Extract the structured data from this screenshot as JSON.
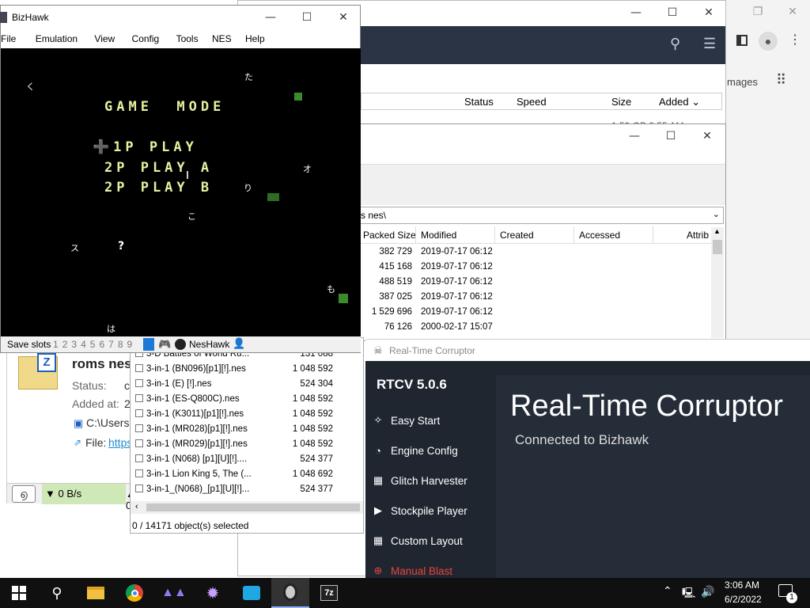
{
  "bg_window": {
    "columns": [
      "Status",
      "Speed",
      "Size",
      "Added"
    ],
    "partial_row": "1.59 GB   8:55 AM",
    "images_label": "mages",
    "detail": {
      "name": "roms nes",
      "status_label": "Status:",
      "status_value": "c",
      "added_label": "Added at:",
      "added_value": "2",
      "path": "C:\\Users",
      "file_label": "File:",
      "file_link": "https"
    },
    "status": {
      "down": "0 B/s",
      "up": "0"
    }
  },
  "zip_window": {
    "path_suffix": "s nes\\",
    "columns": [
      "Packed Size",
      "Modified",
      "Created",
      "Accessed",
      "Attrib"
    ],
    "rows": [
      {
        "packed": "382 729",
        "modified": "2019-07-17 06:12"
      },
      {
        "packed": "415 168",
        "modified": "2019-07-17 06:12"
      },
      {
        "packed": "488 519",
        "modified": "2019-07-17 06:12"
      },
      {
        "packed": "387 025",
        "modified": "2019-07-17 06:12"
      },
      {
        "packed": "1 529 696",
        "modified": "2019-07-17 06:12"
      },
      {
        "packed": "76 126",
        "modified": "2000-02-17 15:07"
      }
    ],
    "files": [
      {
        "name": "3-D Battles of World Ru...",
        "size": "131 088"
      },
      {
        "name": "3-in-1 (BN096)[p1][!].nes",
        "size": "1 048 592"
      },
      {
        "name": "3-in-1 (E) [!].nes",
        "size": "524 304"
      },
      {
        "name": "3-in-1 (ES-Q800C).nes",
        "size": "1 048 592"
      },
      {
        "name": "3-in-1 (K3011)[p1][!].nes",
        "size": "1 048 592"
      },
      {
        "name": "3-in-1 (MR028)[p1][!].nes",
        "size": "1 048 592"
      },
      {
        "name": "3-in-1 (MR029)[p1][!].nes",
        "size": "1 048 592"
      },
      {
        "name": "3-in-1 (N068) [p1][U][!]....",
        "size": "524 377"
      },
      {
        "name": "3-in-1 Lion King 5, The (...",
        "size": "1 048 692"
      },
      {
        "name": "3-in-1_(N068)_[p1][U][!]...",
        "size": "524 377"
      }
    ],
    "status": "0 / 14171 object(s) selected"
  },
  "bizhawk": {
    "title": "BizHawk",
    "menu": [
      "File",
      "Emulation",
      "View",
      "Config",
      "Tools",
      "NES",
      "Help"
    ],
    "game": {
      "heading": "GAME  MODE",
      "options": [
        "➕1P PLAY",
        "2P PLAY A",
        "2P PLAY B"
      ],
      "kana": [
        "く",
        "た",
        "オ",
        "り",
        "こ",
        "ス",
        "?",
        "も",
        "は"
      ]
    },
    "statusbar": {
      "save_label": "Save slots",
      "slots": [
        "1",
        "2",
        "3",
        "4",
        "5",
        "6",
        "7",
        "8",
        "9"
      ],
      "core": "NesHawk"
    }
  },
  "rtcv": {
    "window_title": "Real-Time Corruptor",
    "version": "RTCV 5.0.6",
    "nav": [
      {
        "label": "Easy Start",
        "icon": "✧"
      },
      {
        "label": "Engine Config",
        "icon": "◔"
      },
      {
        "label": "Glitch Harvester",
        "icon": "▦"
      },
      {
        "label": "Stockpile Player",
        "icon": "▶"
      },
      {
        "label": "Custom Layout",
        "icon": "▦"
      },
      {
        "label": "Manual Blast",
        "icon": "⊕"
      }
    ],
    "main_title": "Real-Time Corruptor",
    "connected": "Connected to Bizhawk",
    "accent": "#e8453c",
    "bg": "#1f2630",
    "panel": "#252d38"
  },
  "taskbar": {
    "time": "3:06 AM",
    "date": "6/2/2022",
    "notif_count": "1",
    "apps": [
      "start-icon",
      "search-icon",
      "file-explorer-icon",
      "chrome-icon",
      "app-icon",
      "rtcv-icon",
      "download-icon",
      "bizhawk-icon",
      "7zip-icon"
    ]
  }
}
